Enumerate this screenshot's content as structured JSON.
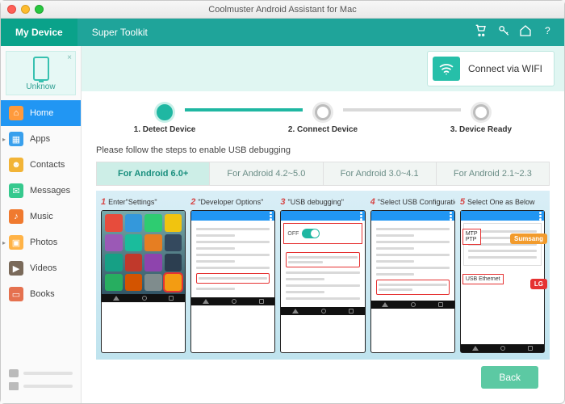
{
  "window": {
    "title": "Coolmuster Android Assistant for Mac"
  },
  "tabs": {
    "primary": "My Device",
    "secondary": "Super Toolkit"
  },
  "device": {
    "name": "Unknow"
  },
  "wifi_button": "Connect via WIFI",
  "sidebar": {
    "items": [
      {
        "label": "Home",
        "color": "#ff9a3c"
      },
      {
        "label": "Apps",
        "color": "#39a0ed"
      },
      {
        "label": "Contacts",
        "color": "#f2b437"
      },
      {
        "label": "Messages",
        "color": "#36c98e"
      },
      {
        "label": "Music",
        "color": "#f07a2f"
      },
      {
        "label": "Photos",
        "color": "#ffb347"
      },
      {
        "label": "Videos",
        "color": "#7a6a5a"
      },
      {
        "label": "Books",
        "color": "#e5714f"
      }
    ]
  },
  "stepper": {
    "s1": "1. Detect Device",
    "s2": "2. Connect Device",
    "s3": "3. Device Ready"
  },
  "intro": "Please follow the steps to enable USB debugging",
  "version_tabs": {
    "t1": "For Android 6.0+",
    "t2": "For Android 4.2~5.0",
    "t3": "For Android 3.0~4.1",
    "t4": "For Android 2.1~2.3"
  },
  "phone_steps": {
    "s1": {
      "num": "1",
      "title": "Enter\"Settings\""
    },
    "s2": {
      "num": "2",
      "title": "\"Developer Options\""
    },
    "s3": {
      "num": "3",
      "title": "\"USB debugging\""
    },
    "s4": {
      "num": "4",
      "title": "\"Select USB Configuration\""
    },
    "s5": {
      "num": "5",
      "title": "Select One as Below"
    }
  },
  "callouts": {
    "mtp_ptp": "MTP\nPTP",
    "usb_eth": "USB Ethernet",
    "samsung": "Sumsang",
    "lg": "LG",
    "off": "OFF"
  },
  "back": "Back",
  "colors": {
    "teal": "#1fb7a2",
    "blue": "#2196f3"
  }
}
